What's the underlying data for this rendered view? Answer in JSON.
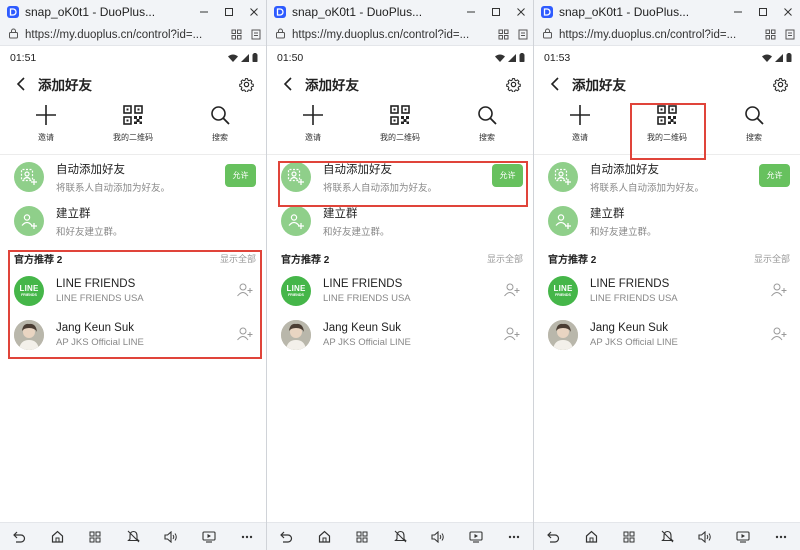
{
  "windows": [
    {
      "title": "snap_oK0t1 - DuoPlus...",
      "url": "https://my.duoplus.cn/control?id=...",
      "status_time": "01:51",
      "header_title": "添加好友",
      "actions": [
        {
          "icon": "plus-icon",
          "label": "邀请"
        },
        {
          "icon": "qrcode-icon",
          "label": "我的二维码"
        },
        {
          "icon": "search-icon",
          "label": "搜索"
        }
      ],
      "auto_add": {
        "title": "自动添加好友",
        "subtitle": "将联系人自动添加为好友。",
        "button": "允许"
      },
      "create_group": {
        "title": "建立群",
        "subtitle": "和好友建立群。"
      },
      "section": {
        "title": "官方推荐 2",
        "more": "显示全部"
      },
      "friends": [
        {
          "name": "LINE FRIENDS",
          "sub": "LINE FRIENDS USA",
          "logo_line1": "LINE",
          "logo_line2": "FRIENDS"
        },
        {
          "name": "Jang Keun Suk",
          "sub": "AP JKS Official LINE"
        }
      ]
    },
    {
      "title": "snap_oK0t1 - DuoPlus...",
      "url": "https://my.duoplus.cn/control?id=...",
      "status_time": "01:50",
      "header_title": "添加好友",
      "actions": [
        {
          "icon": "plus-icon",
          "label": "邀请"
        },
        {
          "icon": "qrcode-icon",
          "label": "我的二维码"
        },
        {
          "icon": "search-icon",
          "label": "搜索"
        }
      ],
      "auto_add": {
        "title": "自动添加好友",
        "subtitle": "将联系人自动添加为好友。",
        "button": "允许"
      },
      "create_group": {
        "title": "建立群",
        "subtitle": "和好友建立群。"
      },
      "section": {
        "title": "官方推荐 2",
        "more": "显示全部"
      },
      "friends": [
        {
          "name": "LINE FRIENDS",
          "sub": "LINE FRIENDS USA",
          "logo_line1": "LINE",
          "logo_line2": "FRIENDS"
        },
        {
          "name": "Jang Keun Suk",
          "sub": "AP JKS Official LINE"
        }
      ]
    },
    {
      "title": "snap_oK0t1 - DuoPlus...",
      "url": "https://my.duoplus.cn/control?id=...",
      "status_time": "01:53",
      "header_title": "添加好友",
      "actions": [
        {
          "icon": "plus-icon",
          "label": "邀请"
        },
        {
          "icon": "qrcode-icon",
          "label": "我的二维码"
        },
        {
          "icon": "search-icon",
          "label": "搜索"
        }
      ],
      "auto_add": {
        "title": "自动添加好友",
        "subtitle": "将联系人自动添加为好友。",
        "button": "允许"
      },
      "create_group": {
        "title": "建立群",
        "subtitle": "和好友建立群。"
      },
      "section": {
        "title": "官方推荐 2",
        "more": "显示全部"
      },
      "friends": [
        {
          "name": "LINE FRIENDS",
          "sub": "LINE FRIENDS USA",
          "logo_line1": "LINE",
          "logo_line2": "FRIENDS"
        },
        {
          "name": "Jang Keun Suk",
          "sub": "AP JKS Official LINE"
        }
      ]
    }
  ],
  "colors": {
    "accent_green": "#67c15e",
    "highlight_red": "#e0443a",
    "line_green": "#45b649"
  }
}
